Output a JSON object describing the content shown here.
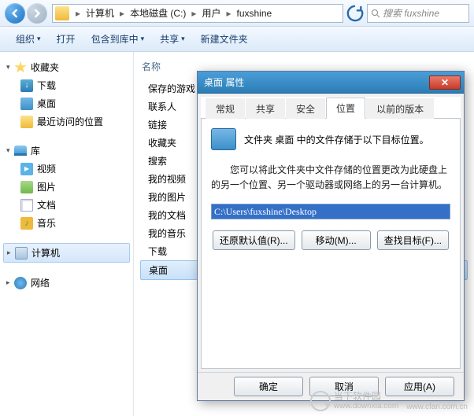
{
  "breadcrumb": {
    "parts": [
      "计算机",
      "本地磁盘 (C:)",
      "用户",
      "fuxshine"
    ]
  },
  "search": {
    "placeholder": "搜索 fuxshine"
  },
  "toolbar": {
    "org": "组织",
    "open": "打开",
    "include": "包含到库中",
    "share": "共享",
    "newfolder": "新建文件夹"
  },
  "nav": {
    "favorites": "收藏夹",
    "downloads": "下载",
    "desktop": "桌面",
    "recent": "最近访问的位置",
    "libraries": "库",
    "videos": "视频",
    "pictures": "图片",
    "documents": "文档",
    "music": "音乐",
    "computer": "计算机",
    "network": "网络"
  },
  "content": {
    "colName": "名称",
    "items": [
      "保存的游戏",
      "联系人",
      "链接",
      "收藏夹",
      "搜索",
      "我的视频",
      "我的图片",
      "我的文档",
      "我的音乐",
      "下载",
      "桌面"
    ]
  },
  "dialog": {
    "title": "桌面 属性",
    "tabs": [
      "常规",
      "共享",
      "安全",
      "位置",
      "以前的版本"
    ],
    "activeTab": 3,
    "infoLine": "文件夹 桌面 中的文件存储于以下目标位置。",
    "desc": "您可以将此文件夹中文件存储的位置更改为此硬盘上的另一个位置、另一个驱动器或网络上的另一台计算机。",
    "path": "C:\\Users\\fuxshine\\Desktop",
    "btnRestore": "还原默认值(R)...",
    "btnMove": "移动(M)...",
    "btnFind": "查找目标(F)...",
    "ok": "确定",
    "cancel": "取消",
    "apply": "应用(A)"
  },
  "watermark": {
    "line1": "当下软件园",
    "line2": "www.downxia.com",
    "extra": "www.cfan.com.cn"
  }
}
